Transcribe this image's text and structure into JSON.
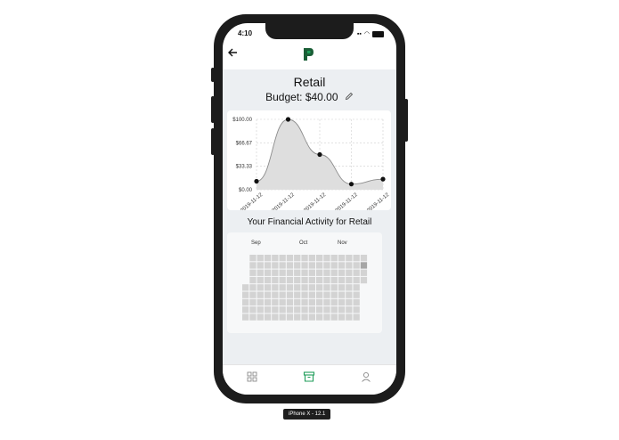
{
  "status_bar": {
    "time": "4:10"
  },
  "header": {
    "logo": "P",
    "back_icon": "arrow-left-icon"
  },
  "page": {
    "title": "Retail",
    "budget": "Budget: $40.00"
  },
  "chart_data": {
    "type": "area",
    "x": [
      "2019-11-12",
      "2019-11-12",
      "2019-11-12",
      "2019-11-12",
      "2019-11-12"
    ],
    "values": [
      12,
      100,
      50,
      8,
      15
    ],
    "y_ticks": [
      "$100.00",
      "$66.67",
      "$33.33",
      "$0.00"
    ],
    "ylim": [
      0,
      100
    ],
    "grid": true
  },
  "activity": {
    "title": "Your Financial Activity for Retail",
    "months": [
      "Sep",
      "Oct",
      "Nov"
    ],
    "highlight_color": "#a6a6a6",
    "cell_color": "#d3d3d3"
  },
  "tabs": [
    {
      "name": "tab-dashboard",
      "icon": "grid-icon"
    },
    {
      "name": "tab-archive",
      "icon": "archive-icon",
      "active": true
    },
    {
      "name": "tab-profile",
      "icon": "user-icon"
    }
  ],
  "device": {
    "label": "iPhone X - 12.1"
  },
  "colors": {
    "accent": "#1f9d5a",
    "logo": "#1a5e36"
  }
}
